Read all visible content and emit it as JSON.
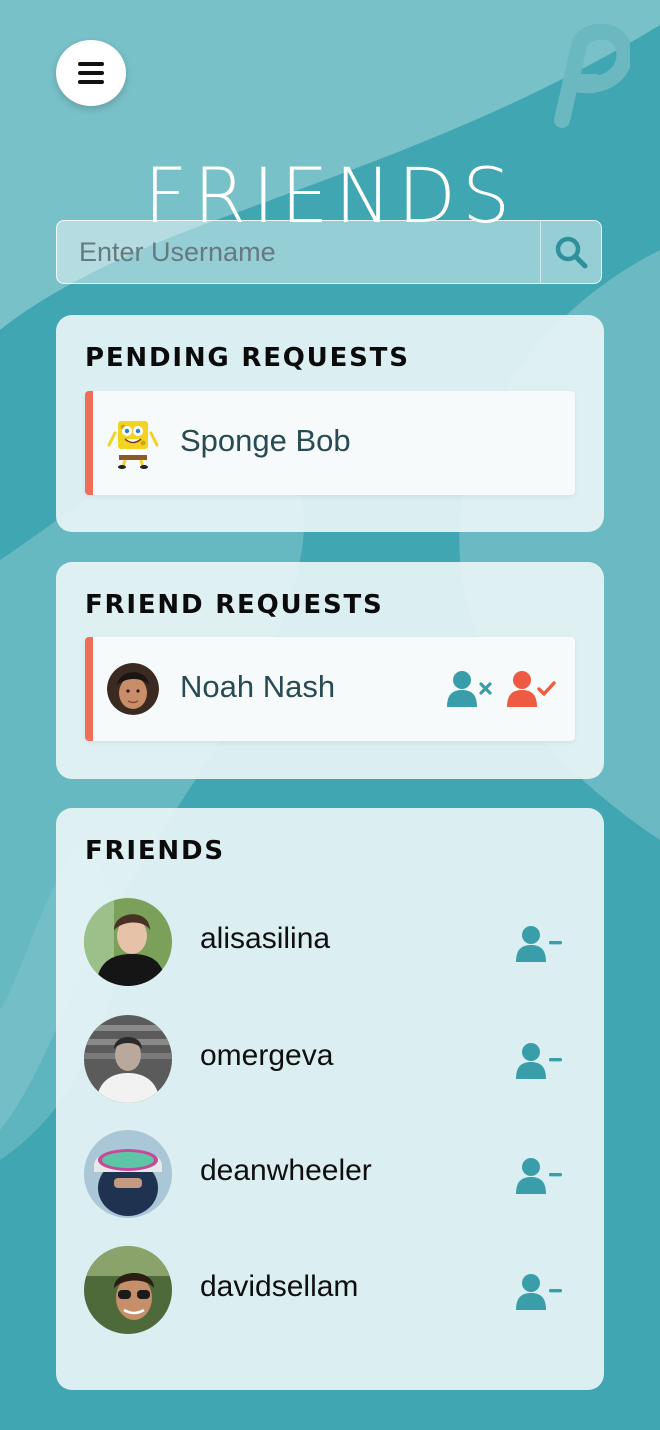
{
  "header": {
    "title": "FRIENDS",
    "menu_icon": "hamburger-menu-icon",
    "logo_icon": "app-logo-p-icon"
  },
  "search": {
    "placeholder": "Enter Username",
    "value": "",
    "icon": "search-icon"
  },
  "pending": {
    "title": "PENDING REQUESTS",
    "items": [
      {
        "name": "Sponge Bob",
        "avatar": "sponge-bob-avatar"
      }
    ]
  },
  "incoming": {
    "title": "FRIEND REQUESTS",
    "items": [
      {
        "name": "Noah Nash",
        "avatar": "noah-nash-avatar",
        "decline_icon": "user-x-icon",
        "accept_icon": "user-check-icon"
      }
    ]
  },
  "friends": {
    "title": "FRIENDS",
    "items": [
      {
        "name": "alisasilina",
        "action_icon": "user-minus-icon"
      },
      {
        "name": "omergeva",
        "action_icon": "user-minus-icon"
      },
      {
        "name": "deanwheeler",
        "action_icon": "user-minus-icon"
      },
      {
        "name": "davidsellam",
        "action_icon": "user-minus-icon"
      }
    ]
  },
  "colors": {
    "background": "#3fa6b2",
    "accent_teal": "#3a9eaa",
    "accent_coral": "#ef6e58",
    "card": "#ecf6f8"
  }
}
